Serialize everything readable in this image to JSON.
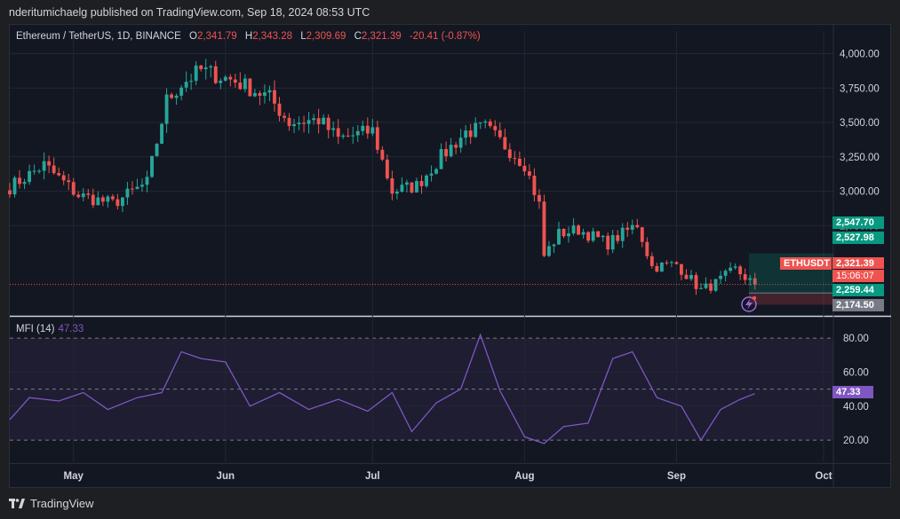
{
  "header": {
    "text": "nderitumichaelg published on TradingView.com, Sep 18, 2024 08:53 UTC"
  },
  "legend": {
    "symbol": "Ethereum / TetherUS, 1D, BINANCE",
    "open_label": "O",
    "open": "2,341.79",
    "high_label": "H",
    "high": "2,343.28",
    "low_label": "L",
    "low": "2,309.69",
    "close_label": "C",
    "close": "2,321.39",
    "change": "-20.41 (-0.87%)"
  },
  "mfi_legend": {
    "name": "MFI (14)",
    "value": "47.33"
  },
  "price_tags": {
    "tp1": "2,547.70",
    "tp2": "2,527.98",
    "symbol_tag": "ETHUSDT",
    "last": "2,321.39",
    "countdown": "15:06:07",
    "entry": "2,259.44",
    "stop": "2,174.50",
    "mfi_last": "47.33"
  },
  "brand": {
    "name": "TradingView"
  },
  "colors": {
    "up": "#26a69a",
    "down": "#ef5350",
    "mfi": "#7e57c2",
    "bg": "#131722"
  },
  "chart_data": [
    {
      "type": "candlestick",
      "title": "Ethereum / TetherUS, 1D, BINANCE",
      "y_ticks": [
        "4,000.00",
        "3,750.00",
        "3,500.00",
        "3,250.00",
        "3,000.00",
        "2,750.00"
      ],
      "ylim": [
        2100,
        4100
      ],
      "x_ticks": [
        "May",
        "Jun",
        "Jul",
        "Aug",
        "Sep",
        "Oct"
      ],
      "x_tick_dates": [
        "2024-05-01",
        "2024-06-01",
        "2024-07-01",
        "2024-08-01",
        "2024-09-01",
        "2024-10-01"
      ],
      "xlim": [
        "2024-04-18",
        "2024-10-03"
      ],
      "close_series": {
        "dates": [
          "2024-04-18",
          "2024-04-25",
          "2024-05-02",
          "2024-05-09",
          "2024-05-16",
          "2024-05-20",
          "2024-05-23",
          "2024-05-27",
          "2024-06-03",
          "2024-06-10",
          "2024-06-14",
          "2024-06-20",
          "2024-06-24",
          "2024-07-01",
          "2024-07-05",
          "2024-07-10",
          "2024-07-15",
          "2024-07-20",
          "2024-07-24",
          "2024-08-01",
          "2024-08-04",
          "2024-08-05",
          "2024-08-08",
          "2024-08-12",
          "2024-08-18",
          "2024-08-24",
          "2024-08-27",
          "2024-09-01",
          "2024-09-06",
          "2024-09-09",
          "2024-09-13",
          "2024-09-17"
        ],
        "close": [
          3030,
          3190,
          2970,
          2910,
          3060,
          3660,
          3780,
          3880,
          3800,
          3680,
          3500,
          3520,
          3380,
          3440,
          3000,
          3040,
          3250,
          3430,
          3460,
          3200,
          2900,
          2530,
          2690,
          2720,
          2620,
          2760,
          2450,
          2470,
          2280,
          2330,
          2430,
          2321.39
        ]
      },
      "last_price": 2321.39
    },
    {
      "type": "line",
      "title": "MFI (14)",
      "y_ticks": [
        "80.00",
        "60.00",
        "40.00",
        "20.00"
      ],
      "ylim": [
        7,
        90
      ],
      "band": [
        20,
        80
      ],
      "dates": [
        "2024-04-18",
        "2024-04-22",
        "2024-04-28",
        "2024-05-03",
        "2024-05-08",
        "2024-05-14",
        "2024-05-19",
        "2024-05-23",
        "2024-05-27",
        "2024-06-01",
        "2024-06-06",
        "2024-06-12",
        "2024-06-18",
        "2024-06-24",
        "2024-06-30",
        "2024-07-05",
        "2024-07-09",
        "2024-07-14",
        "2024-07-19",
        "2024-07-23",
        "2024-07-27",
        "2024-08-01",
        "2024-08-05",
        "2024-08-09",
        "2024-08-14",
        "2024-08-19",
        "2024-08-23",
        "2024-08-28",
        "2024-09-02",
        "2024-09-06",
        "2024-09-10",
        "2024-09-14",
        "2024-09-17"
      ],
      "values": [
        32,
        45,
        43,
        48,
        38,
        45,
        48,
        72,
        68,
        66,
        40,
        48,
        38,
        44,
        37,
        48,
        25,
        42,
        50,
        82,
        49,
        22,
        18,
        28,
        30,
        68,
        72,
        45,
        40,
        20,
        38,
        44,
        47.33
      ]
    }
  ]
}
